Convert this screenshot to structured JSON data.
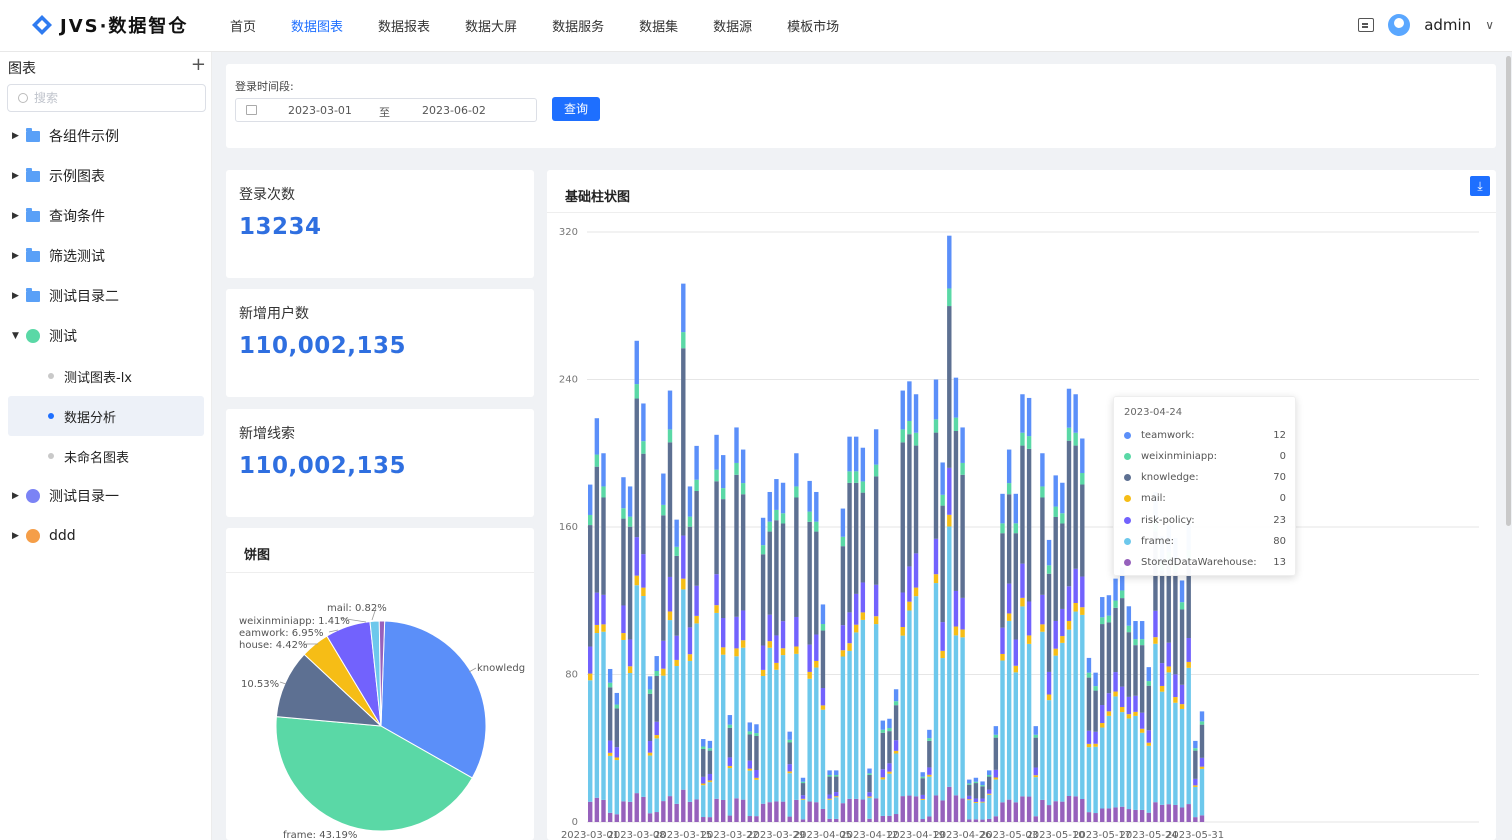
{
  "header": {
    "logo_text": "JVS·数据智仓",
    "nav": [
      "首页",
      "数据图表",
      "数据报表",
      "数据大屏",
      "数据服务",
      "数据集",
      "数据源",
      "模板市场"
    ],
    "active_nav": "数据图表",
    "user": "admin"
  },
  "sidebar": {
    "title": "图表",
    "search_placeholder": "搜索",
    "items": [
      {
        "label": "各组件示例",
        "type": "folder",
        "expanded": false
      },
      {
        "label": "示例图表",
        "type": "folder",
        "expanded": false
      },
      {
        "label": "查询条件",
        "type": "folder",
        "expanded": false
      },
      {
        "label": "筛选测试",
        "type": "folder",
        "expanded": false
      },
      {
        "label": "测试目录二",
        "type": "folder",
        "expanded": false
      },
      {
        "label": "测试",
        "type": "group",
        "expanded": true
      },
      {
        "label": "测试图表-lx",
        "type": "leaf"
      },
      {
        "label": "数据分析",
        "type": "leaf",
        "selected": true
      },
      {
        "label": "未命名图表",
        "type": "leaf"
      },
      {
        "label": "测试目录一",
        "type": "group",
        "expanded": false
      },
      {
        "label": "ddd",
        "type": "group",
        "expanded": false
      }
    ]
  },
  "filter": {
    "label": "登录时间段:",
    "start": "2023-03-01",
    "separator": "至",
    "end": "2023-06-02",
    "query_label": "查询"
  },
  "kpis": [
    {
      "label": "登录次数",
      "value": "13234"
    },
    {
      "label": "新增用户数",
      "value": "110,002,135"
    },
    {
      "label": "新增线索",
      "value": "110,002,135"
    }
  ],
  "pie": {
    "title": "饼图",
    "labels": {
      "mail": "mail: 0.82%",
      "weixin": "weixinminiapp: 1.41%",
      "teamwork": "eamwork: 6.95%",
      "house": "house: 4.42%",
      "knowledge": "knowledg",
      "dark": "10.53%",
      "frame": "frame: 43.19%"
    }
  },
  "bar_chart": {
    "title": "基础柱状图",
    "tooltip": {
      "date": "2023-04-24",
      "rows": [
        {
          "name": "teamwork:",
          "value": "12",
          "color": "#5b8ff9"
        },
        {
          "name": "weixinminiapp:",
          "value": "0",
          "color": "#5ad8a6"
        },
        {
          "name": "knowledge:",
          "value": "70",
          "color": "#5d7092"
        },
        {
          "name": "mail:",
          "value": "0",
          "color": "#f6bd16"
        },
        {
          "name": "risk-policy:",
          "value": "23",
          "color": "#7262fd"
        },
        {
          "name": "frame:",
          "value": "80",
          "color": "#6dc8ec"
        },
        {
          "name": "StoredDataWarehouse:",
          "value": "13",
          "color": "#9661bc"
        }
      ]
    }
  },
  "chart_data": {
    "type": "bar",
    "stacked": true,
    "ylim": [
      0,
      320
    ],
    "yticks": [
      0,
      80,
      160,
      240,
      320
    ],
    "xticks": [
      "2023-03-01",
      "2023-03-08",
      "2023-03-15",
      "2023-03-22",
      "2023-03-29",
      "2023-04-05",
      "2023-04-12",
      "2023-04-19",
      "2023-04-26",
      "2023-05-03",
      "2023-05-10",
      "2023-05-17",
      "2023-05-24",
      "2023-05-31"
    ],
    "series_colors": {
      "frame": "#6dc8ec",
      "StoredDataWarehouse": "#9661bc",
      "risk-policy": "#7262fd",
      "mail": "#f6bd16",
      "knowledge": "#5d7092",
      "weixinminiapp": "#5ad8a6",
      "teamwork": "#5b8ff9"
    },
    "totals": [
      183,
      219,
      200,
      83,
      70,
      187,
      182,
      261,
      227,
      79,
      90,
      189,
      234,
      164,
      292,
      182,
      204,
      45,
      44,
      210,
      199,
      58,
      214,
      202,
      54,
      53,
      165,
      179,
      186,
      184,
      49,
      200,
      24,
      185,
      179,
      118,
      28,
      28,
      170,
      209,
      209,
      203,
      29,
      213,
      55,
      56,
      72,
      234,
      239,
      232,
      27,
      50,
      240,
      195,
      318,
      241,
      214,
      23,
      24,
      22,
      28,
      52,
      178,
      202,
      178,
      232,
      230,
      52,
      200,
      153,
      188,
      184,
      235,
      232,
      208,
      89,
      81,
      122,
      123,
      132,
      138,
      117,
      109,
      109,
      84,
      179,
      155,
      161,
      154,
      131,
      162,
      44,
      60
    ],
    "pie": [
      {
        "name": "frame",
        "percent": 43.19,
        "color": "#5ad8a6"
      },
      {
        "name": "knowledge",
        "percent": 32.68,
        "color": "#5b8ff9"
      },
      {
        "name": "(unlabeled)",
        "percent": 10.53,
        "color": "#5d7092"
      },
      {
        "name": "house",
        "percent": 4.42,
        "color": "#f6bd16"
      },
      {
        "name": "teamwork",
        "percent": 6.95,
        "color": "#7262fd"
      },
      {
        "name": "weixinminiapp",
        "percent": 1.41,
        "color": "#6dc8ec"
      },
      {
        "name": "mail",
        "percent": 0.82,
        "color": "#9661bc"
      }
    ]
  }
}
